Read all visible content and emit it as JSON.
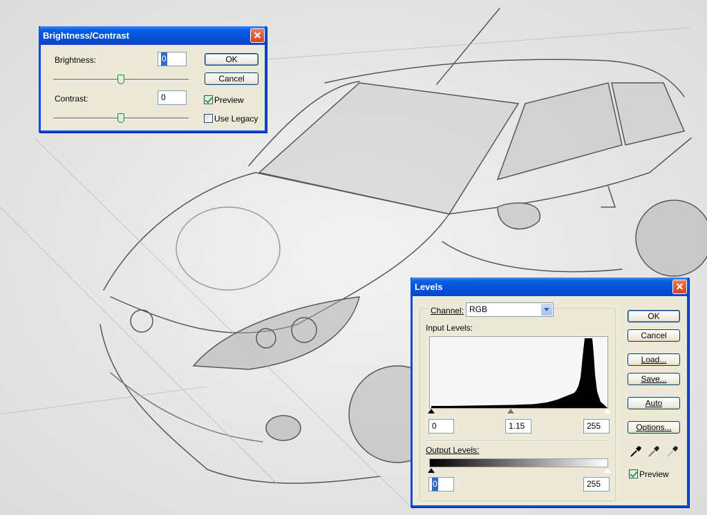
{
  "brightness_contrast": {
    "title": "Brightness/Contrast",
    "brightness_label": "Brightness:",
    "brightness_value": "0",
    "contrast_label": "Contrast:",
    "contrast_value": "0",
    "ok_label": "OK",
    "cancel_label": "Cancel",
    "preview_label": "Preview",
    "preview_checked": true,
    "legacy_label": "Use Legacy",
    "legacy_checked": false,
    "brightness_slider_fraction": 0.5,
    "contrast_slider_fraction": 0.5
  },
  "levels": {
    "title": "Levels",
    "channel_label": "Channel:",
    "channel_value": "RGB",
    "input_levels_label": "Input Levels:",
    "input_black": "0",
    "input_gamma": "1.15",
    "input_white": "255",
    "output_levels_label": "Output Levels:",
    "output_black": "0",
    "output_white": "255",
    "ok_label": "OK",
    "cancel_label": "Cancel",
    "load_label": "Load...",
    "save_label": "Save...",
    "auto_label": "Auto",
    "options_label": "Options...",
    "preview_label": "Preview",
    "preview_checked": true,
    "eyedroppers": [
      "black-eyedropper-icon",
      "gray-eyedropper-icon",
      "white-eyedropper-icon"
    ]
  },
  "colors": {
    "titlebar": "#0553d8",
    "dialog_bg": "#ece9d8",
    "selection": "#316ac5"
  }
}
